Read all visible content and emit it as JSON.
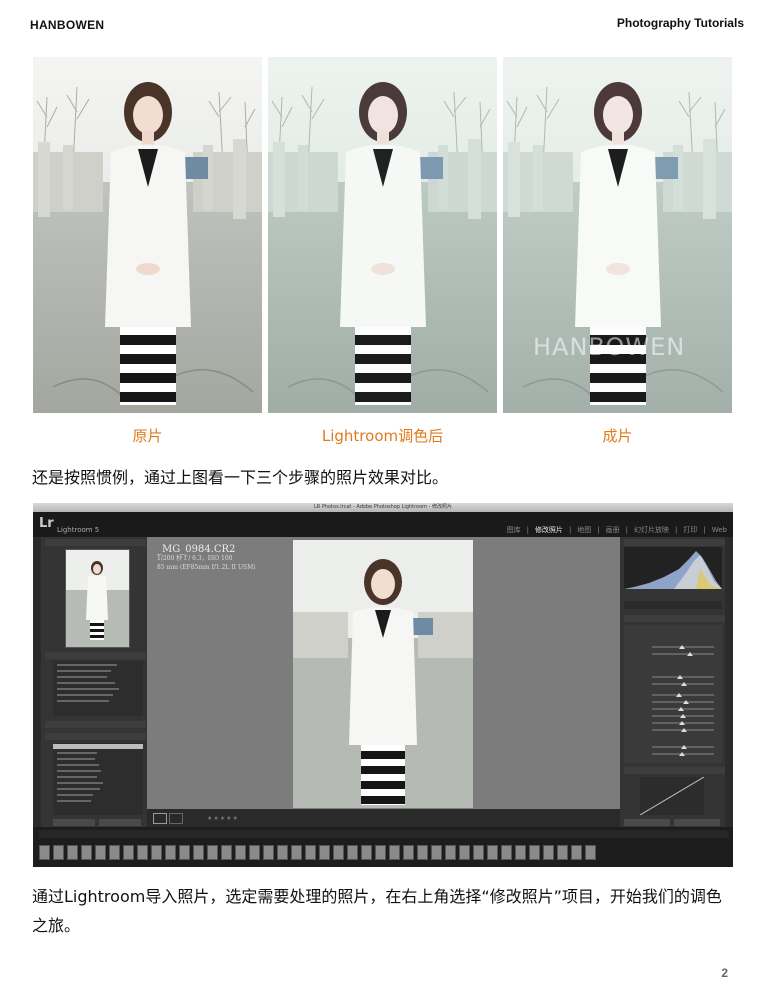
{
  "header": {
    "left": "HANBOWEN",
    "right": "Photography Tutorials"
  },
  "photos": [
    {
      "caption": "原片",
      "tone": "original"
    },
    {
      "caption": "Lightroom调色后",
      "tone": "lightroom"
    },
    {
      "caption": "成片",
      "tone": "final",
      "watermark": "HANBOWEN"
    }
  ],
  "paragraph1": "还是按照惯例，通过上图看一下三个步骤的照片效果对比。",
  "lightroom": {
    "window_title": "LR Photos.lrcat - Adobe Photoshop Lightroom - 修改照片",
    "logo": "Lr",
    "brand": "Lightroom 5",
    "modules": [
      "图库",
      "修改照片",
      "地图",
      "画册",
      "幻灯片放映",
      "打印",
      "Web"
    ],
    "active_module": "修改照片",
    "file_name": "_MG_0984.CR2",
    "exif_line1": "1/200 秒 f / 6.3，ISO 100",
    "exif_line2": "85 mm (EF85mm f/1.2L II USM)"
  },
  "paragraph2": "通过Lightroom导入照片，选定需要处理的照片，在右上角选择“修改照片”项目，开始我们的调色之旅。",
  "page_number": "2"
}
